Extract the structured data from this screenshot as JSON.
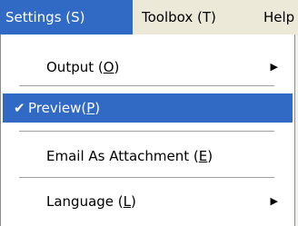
{
  "menubar": {
    "items": [
      {
        "label": "Settings (S)"
      },
      {
        "label": "Toolbox (T)"
      },
      {
        "label": "Help"
      }
    ]
  },
  "dropdown": {
    "items": [
      {
        "prefix": "Output (",
        "hotkey": "O",
        "suffix": ")",
        "submenu_icon": "submenu-arrow-icon"
      },
      {
        "prefix": "Preview(",
        "hotkey": "P",
        "suffix": ")",
        "checked": true,
        "check_icon": "checkmark-icon",
        "selected": true
      },
      {
        "prefix": "Email As Attachment (",
        "hotkey": "E",
        "suffix": ")"
      },
      {
        "prefix": "Language (",
        "hotkey": "L",
        "suffix": ")",
        "submenu_icon": "submenu-arrow-icon"
      }
    ]
  },
  "colors": {
    "highlight": "#316ac5",
    "menubar_bg": "#ece9d8",
    "menu_bg": "#ffffff"
  }
}
